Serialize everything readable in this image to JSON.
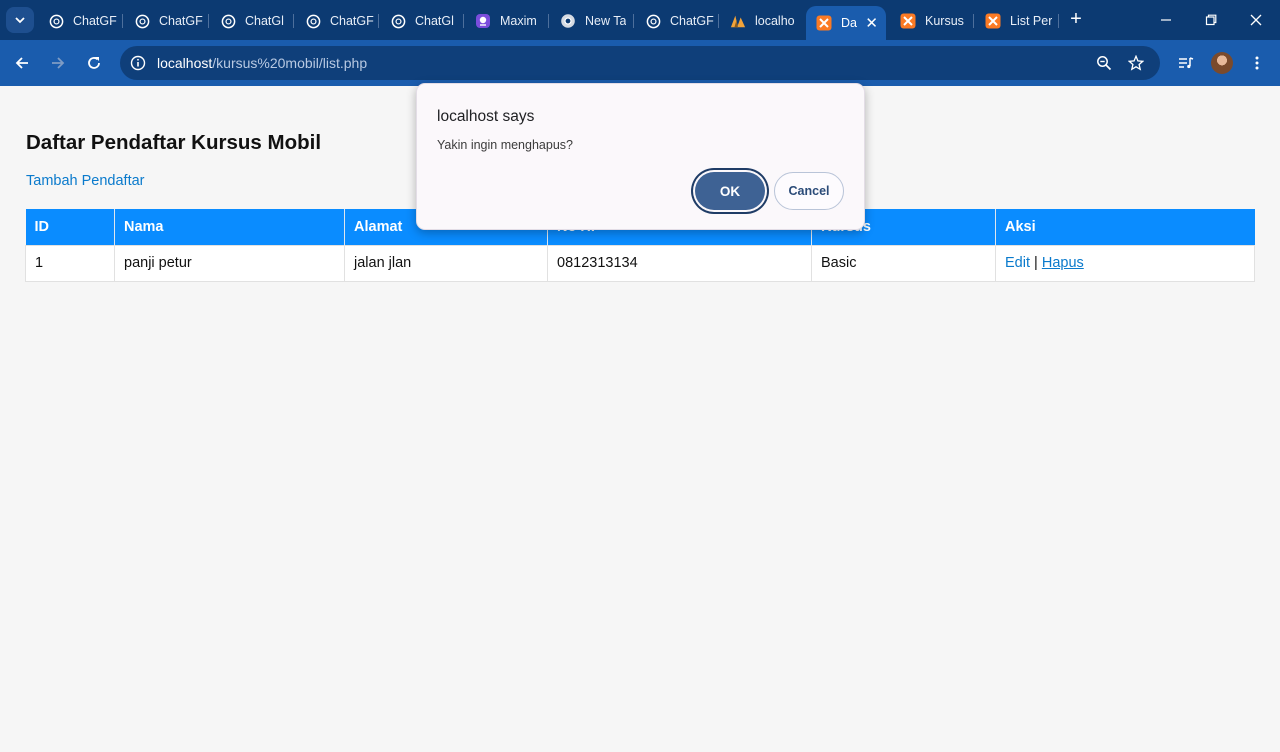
{
  "browser": {
    "tabs": [
      {
        "title": "ChatGF",
        "icon": "chatgpt-icon"
      },
      {
        "title": "ChatGF",
        "icon": "chatgpt-icon"
      },
      {
        "title": "ChatGl",
        "icon": "chatgpt-icon"
      },
      {
        "title": "ChatGF",
        "icon": "chatgpt-icon"
      },
      {
        "title": "ChatGl",
        "icon": "chatgpt-icon"
      },
      {
        "title": "Maxim",
        "icon": "maxim-icon"
      },
      {
        "title": "New Ta",
        "icon": "chrome-icon"
      },
      {
        "title": "ChatGF",
        "icon": "chatgpt-icon"
      },
      {
        "title": "localho",
        "icon": "phpmyadmin-icon"
      },
      {
        "title": "Da",
        "icon": "xampp-icon",
        "active": true
      },
      {
        "title": "Kursus",
        "icon": "xampp-icon"
      },
      {
        "title": "List Per",
        "icon": "xampp-icon"
      }
    ],
    "new_tab_symbol": "+",
    "url_host": "localhost",
    "url_path": "/kursus%20mobil/list.php",
    "active_tab_color": "#1a5cad",
    "frame_color": "#0c3a72"
  },
  "page": {
    "heading": "Daftar Pendaftar Kursus Mobil",
    "add_link": "Tambah Pendaftar",
    "table": {
      "headers": [
        "ID",
        "Nama",
        "Alamat",
        "No HP",
        "Kursus",
        "Aksi"
      ],
      "rows": [
        {
          "id": "1",
          "nama": "panji petur",
          "alamat": "jalan jlan",
          "no_hp": "0812313134",
          "kursus": "Basic",
          "edit": "Edit",
          "sep": "|",
          "hapus": "Hapus"
        }
      ]
    },
    "header_color": "#0a8cff",
    "link_color": "#0a7acc"
  },
  "dialog": {
    "title": "localhost says",
    "message": "Yakin ingin menghapus?",
    "ok_label": "OK",
    "cancel_label": "Cancel",
    "ok_color": "#3e6294"
  }
}
